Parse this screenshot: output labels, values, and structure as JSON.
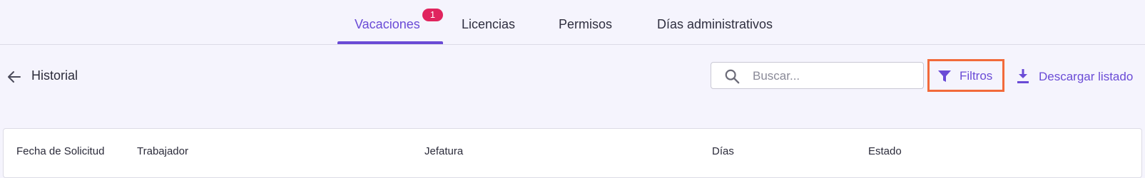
{
  "tabs": [
    {
      "label": "Vacaciones",
      "active": true,
      "badge": "1"
    },
    {
      "label": "Licencias",
      "active": false
    },
    {
      "label": "Permisos",
      "active": false
    },
    {
      "label": "Días administrativos",
      "active": false
    }
  ],
  "header": {
    "back_icon": "arrow-left-icon",
    "title": "Historial"
  },
  "toolbar": {
    "search_placeholder": "Buscar...",
    "search_value": "",
    "search_icon": "search-icon",
    "filter_label": "Filtros",
    "filter_icon": "filter-icon",
    "download_label": "Descargar listado",
    "download_icon": "download-icon"
  },
  "table": {
    "columns": [
      "Fecha de Solicitud",
      "Trabajador",
      "Jefatura",
      "Días",
      "Estado"
    ]
  },
  "colors": {
    "accent": "#6a4bd6",
    "badge": "#e0245e",
    "highlight_border": "#f26a3a",
    "background": "#f5f4fd"
  }
}
